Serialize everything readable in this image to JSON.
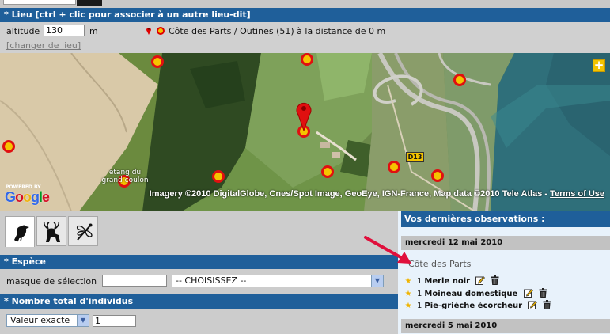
{
  "lieu": {
    "header": "* Lieu [ctrl + clic pour associer à un autre lieu-dit]",
    "altitude_label": "altitude",
    "altitude_value": "130",
    "altitude_unit": "m",
    "place_text": "Côte des Parts / Outines (51) à la distance de 0 m",
    "change_link": "[changer de lieu]"
  },
  "map": {
    "zoom_button": "+",
    "label_etang": "etang du\ngrand coulon",
    "road_sign": "D13",
    "powered_by": "POWERED BY",
    "google_letters": [
      "G",
      "o",
      "o",
      "g",
      "l",
      "e"
    ],
    "google_colors": [
      "#3369e8",
      "#d50f25",
      "#eeb211",
      "#3369e8",
      "#009925",
      "#d50f25"
    ],
    "copyright": "Imagery ©2010 DigitalGlobe, Cnes/Spot Image, GeoEye, IGN-France, Map data ©2010 Tele Atlas - ",
    "terms": "Terms of Use",
    "marker_color": "#f5c400",
    "marker_border": "#e01010"
  },
  "tabs": [
    {
      "name": "oiseaux",
      "icon": "bird-icon",
      "active": true
    },
    {
      "name": "mammiferes",
      "icon": "deer-icon",
      "active": false
    },
    {
      "name": "insectes",
      "icon": "dragonfly-icon",
      "active": false
    }
  ],
  "espece": {
    "header": "* Espèce",
    "masque_label": "masque de sélection",
    "masque_value": "",
    "select_value": "-- CHOISISSEZ --"
  },
  "nombre": {
    "header": "* Nombre total d'individus",
    "select_value": "Valeur exacte",
    "count_value": "1"
  },
  "observations": {
    "header": "Vos dernières observations :",
    "dates": [
      "mercredi 12 mai 2010",
      "mercredi 5 mai 2010"
    ],
    "place": "Côte des Parts",
    "items": [
      {
        "qty": "1",
        "name": "Merle noir"
      },
      {
        "qty": "1",
        "name": "Moineau domestique"
      },
      {
        "qty": "1",
        "name": "Pie-grièche écorcheur"
      }
    ]
  },
  "colors": {
    "header_blue": "#1f5f9a",
    "panel_gray": "#cccccc",
    "obs_bg": "#e8f2fb",
    "arrow_red": "#e0103c"
  }
}
